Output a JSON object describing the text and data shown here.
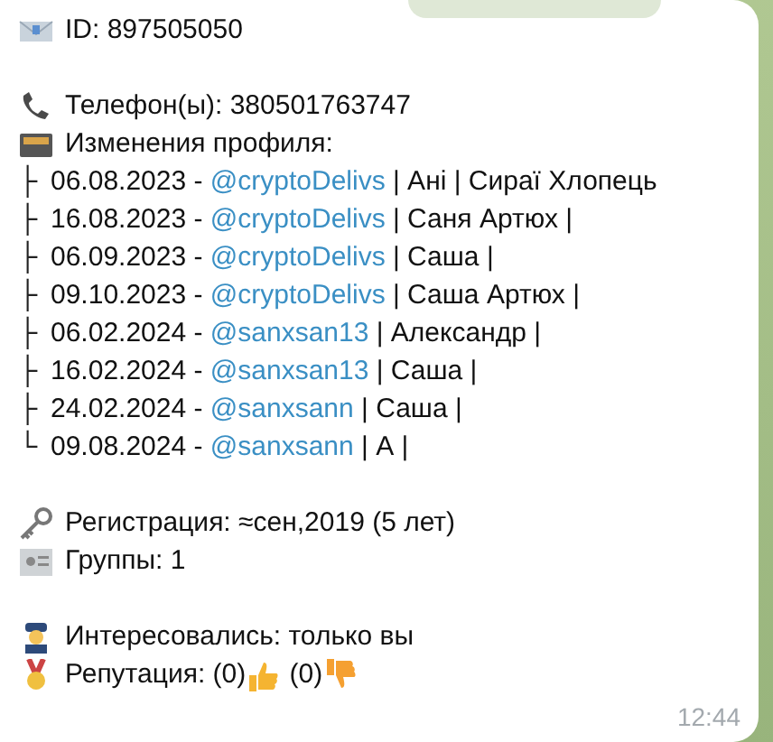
{
  "id_line": "ID: 897505050",
  "phone": "Телефон(ы): 380501763747",
  "changes_title": "Изменения профиля:",
  "history": [
    {
      "branch": "├",
      "date": "06.08.2023 - ",
      "username": "@cryptoDelivs",
      "rest": " | Ані | Сираї Хлопець"
    },
    {
      "branch": "├",
      "date": "16.08.2023 - ",
      "username": "@cryptoDelivs",
      "rest": " | Саня Артюх |"
    },
    {
      "branch": "├",
      "date": "06.09.2023 - ",
      "username": "@cryptoDelivs",
      "rest": " | Саша |"
    },
    {
      "branch": "├",
      "date": "09.10.2023 - ",
      "username": "@cryptoDelivs",
      "rest": " | Саша Артюх |"
    },
    {
      "branch": "├",
      "date": "06.02.2024 - ",
      "username": "@sanxsan13",
      "rest": " | Александр |"
    },
    {
      "branch": "├",
      "date": "16.02.2024 - ",
      "username": "@sanxsan13",
      "rest": " | Саша |"
    },
    {
      "branch": "├",
      "date": "24.02.2024 - ",
      "username": "@sanxsann",
      "rest": " | Саша |"
    },
    {
      "branch": "└",
      "date": "09.08.2024 - ",
      "username": "@sanxsann",
      "rest": " | А |"
    }
  ],
  "registration": "Регистрация: ≈сен,2019 (5 лет)",
  "groups": "Группы: 1",
  "interested": "Интересовались: только вы",
  "reputation": {
    "label": "Репутация: ",
    "likes": "(0)",
    "dislikes": " (0)"
  },
  "time": "12:44"
}
